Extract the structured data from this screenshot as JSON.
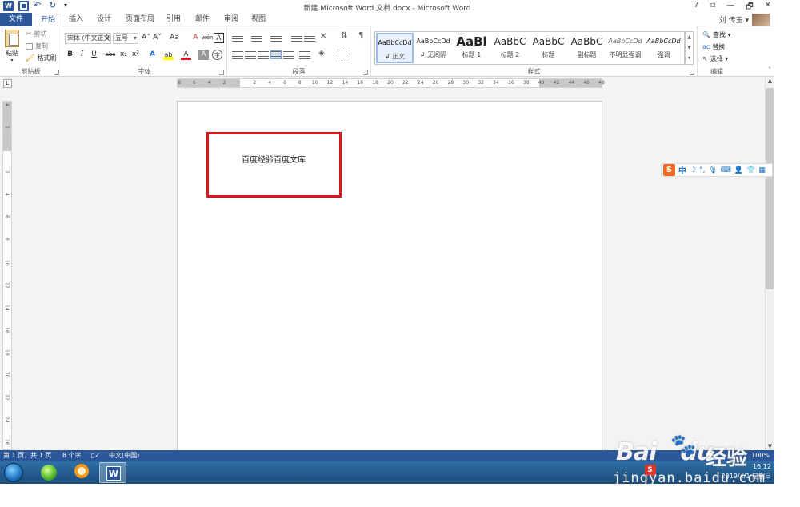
{
  "window": {
    "title": "新建 Microsoft Word 文档.docx - Microsoft Word",
    "controls": [
      "?",
      "⧉",
      "—",
      "🗗",
      "✕"
    ]
  },
  "qat": {
    "app_icon": "W",
    "save": "save-icon",
    "undo": "undo-icon",
    "redo": "redo-icon"
  },
  "tabs": [
    {
      "label": "文件"
    },
    {
      "label": "开始"
    },
    {
      "label": "插入"
    },
    {
      "label": "设计"
    },
    {
      "label": "页面布局"
    },
    {
      "label": "引用"
    },
    {
      "label": "邮件"
    },
    {
      "label": "审阅"
    },
    {
      "label": "视图"
    }
  ],
  "user": {
    "name": "刘 传玉 ▾"
  },
  "ribbon": {
    "clipboard": {
      "label": "剪贴板",
      "paste": "粘贴",
      "cut": "剪切",
      "copy": "复制",
      "format_painter": "格式刷"
    },
    "font": {
      "label": "字体",
      "font_name": "宋体 (中文正文)",
      "font_size": "五号",
      "bold": "B",
      "italic": "I",
      "underline": "U",
      "strike": "abc",
      "sub": "x₂",
      "sup": "x²",
      "grow": "A˄",
      "shrink": "A˅",
      "case": "Aa",
      "clear": "A",
      "phonetic": "wén",
      "border": "A",
      "effects": "A",
      "highlight": "ab",
      "color": "A",
      "shade": "A",
      "circle": "字"
    },
    "paragraph": {
      "label": "段落"
    },
    "styles": {
      "label": "样式",
      "items": [
        {
          "sample": "AaBbCcDd",
          "name": "↲ 正文"
        },
        {
          "sample": "AaBbCcDd",
          "name": "↲ 无间隔"
        },
        {
          "sample": "AaBl",
          "name": "标题 1"
        },
        {
          "sample": "AaBbC",
          "name": "标题 2"
        },
        {
          "sample": "AaBbC",
          "name": "标题"
        },
        {
          "sample": "AaBbC",
          "name": "副标题"
        },
        {
          "sample": "AaBbCcDd",
          "name": "不明显强调"
        },
        {
          "sample": "AaBbCcDd",
          "name": "强调"
        }
      ]
    },
    "editing": {
      "label": "编辑",
      "find": "查找 ▾",
      "replace": "替换",
      "select": "选择 ▾"
    }
  },
  "ruler": {
    "corner": "L",
    "ticks": [
      "8",
      "6",
      "4",
      "2",
      "",
      "2",
      "4",
      "6",
      "8",
      "10",
      "12",
      "14",
      "16",
      "18",
      "20",
      "22",
      "24",
      "26",
      "28",
      "30",
      "32",
      "34",
      "36",
      "38",
      "40",
      "42",
      "44",
      "46",
      "48"
    ],
    "vticks": [
      "4",
      "2",
      "",
      "2",
      "4",
      "6",
      "8",
      "10",
      "12",
      "14",
      "16",
      "18",
      "20",
      "22",
      "24",
      "26"
    ]
  },
  "document": {
    "text": "百度经验百度文库"
  },
  "ime": {
    "logo": "S",
    "mode": "中",
    "icons": [
      "☽",
      "°,",
      "🎙",
      "⌨",
      "👤",
      "👕",
      "▦"
    ]
  },
  "status": {
    "page": "第 1 页，共 1 页",
    "words": "8 个字",
    "language": "中文(中国)",
    "zoom": "100%"
  },
  "taskbar": {
    "time": "16:12",
    "date": "2019/4/1 星期日",
    "tray_s": "S"
  },
  "watermark": {
    "logo": "Bai",
    "logo2": "du",
    "cn": "经验",
    "url": "jingyan.baidu.com"
  },
  "colors": {
    "word_blue": "#2b579a",
    "highlight_red": "#e0151c"
  }
}
